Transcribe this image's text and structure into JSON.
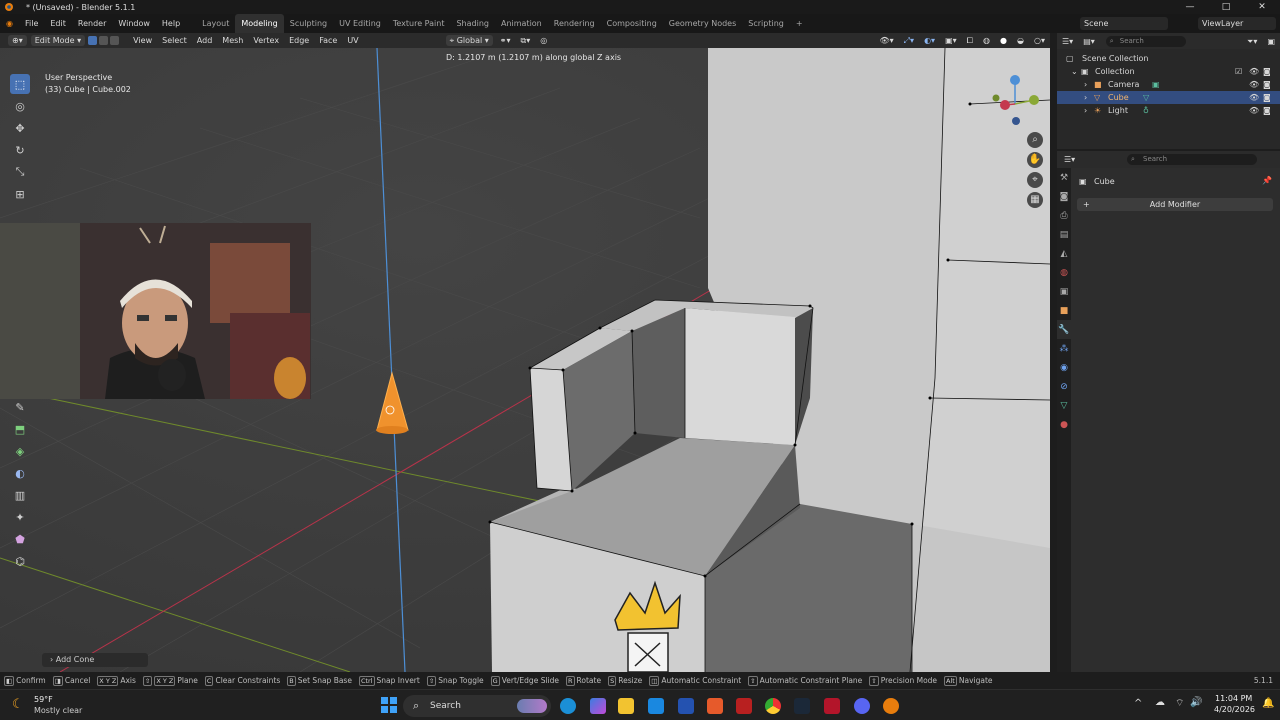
{
  "window": {
    "title": "* (Unsaved) - Blender 5.1.1",
    "controls": [
      "—",
      "□",
      "✕"
    ]
  },
  "menu": [
    "File",
    "Edit",
    "Render",
    "Window",
    "Help"
  ],
  "workspaces": [
    "Layout",
    "Modeling",
    "Sculpting",
    "UV Editing",
    "Texture Paint",
    "Shading",
    "Animation",
    "Rendering",
    "Compositing",
    "Geometry Nodes",
    "Scripting"
  ],
  "workspace_add": "+",
  "scene": {
    "name": "Scene",
    "view_layer": "ViewLayer"
  },
  "viewport_header": {
    "mode": "Edit Mode",
    "menus": [
      "View",
      "Select",
      "Add",
      "Mesh",
      "Vertex",
      "Edge",
      "Face",
      "UV"
    ],
    "orientation": "Global"
  },
  "viewport": {
    "perspective": "User Perspective",
    "object_info": "(33) Cube | Cube.002",
    "transform_hint": "D:  1.2107 m (1.2107 m) along global Z axis",
    "gizmo_axes": [
      "Z",
      "Y",
      "X"
    ],
    "last_operator": "Add Cone"
  },
  "outliner": {
    "search_placeholder": "Search",
    "rows": [
      {
        "label": "Scene Collection"
      },
      {
        "label": "Collection"
      },
      {
        "label": "Camera"
      },
      {
        "label": "Cube"
      },
      {
        "label": "Light"
      }
    ]
  },
  "properties": {
    "search_placeholder": "Search",
    "object_name": "Cube",
    "add_modifier": "Add Modifier"
  },
  "statusbar": {
    "items": [
      {
        "key": "",
        "label": "Confirm"
      },
      {
        "key": "",
        "label": "Cancel"
      },
      {
        "key": "X Y Z",
        "label": "Axis"
      },
      {
        "key": "X Y Z",
        "label": "Plane"
      },
      {
        "key": "C",
        "label": "Clear Constraints"
      },
      {
        "key": "B",
        "label": "Set Snap Base"
      },
      {
        "key": "Ctrl",
        "label": "Snap Invert"
      },
      {
        "key": "",
        "label": "Snap Toggle"
      },
      {
        "key": "G",
        "label": "Vert/Edge Slide"
      },
      {
        "key": "R",
        "label": "Rotate"
      },
      {
        "key": "S",
        "label": "Resize"
      },
      {
        "key": "",
        "label": "Automatic Constraint"
      },
      {
        "key": "",
        "label": "Automatic Constraint Plane"
      },
      {
        "key": "",
        "label": "Precision Mode"
      },
      {
        "key": "Alt",
        "label": "Navigate"
      }
    ],
    "version": "5.1.1"
  },
  "taskbar": {
    "weather_temp": "59°F",
    "weather_desc": "Mostly clear",
    "search": "Search",
    "time": "11:04 PM",
    "date": "4/20/2026",
    "chevron": "^"
  },
  "colors": {
    "accent": "#4772b3",
    "selected_row": "#334d80",
    "x_axis": "#c4394e",
    "y_axis": "#8aa836",
    "z_axis": "#4d8fd6",
    "cone": "#f0922d"
  }
}
